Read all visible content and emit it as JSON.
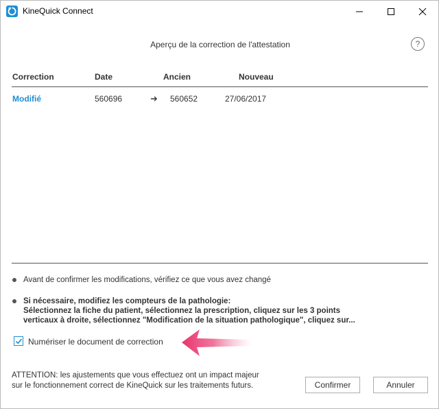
{
  "window": {
    "title": "KineQuick Connect",
    "icons": {
      "app": "kinequick-app-icon",
      "minimize": "minimize-icon",
      "maximize": "maximize-icon",
      "close": "close-icon"
    }
  },
  "dialog": {
    "title": "Aperçu de la correction de l'attestation",
    "help_icon": "?"
  },
  "table": {
    "headers": [
      "Correction",
      "Date",
      "Ancien",
      "Nouveau"
    ],
    "rows": [
      {
        "correction": "Modifié",
        "date": "560696",
        "arrow": "➜",
        "ancien": "560652",
        "nouveau": "27/06/2017"
      }
    ]
  },
  "notes": {
    "note1": "Avant de confirmer les modifications, vérifiez ce que vous avez changé",
    "note2_line1": "Si nécessaire, modifiez les compteurs de la pathologie:",
    "note2_line2": "Sélectionnez la fiche du patient, sélectionnez la prescription, cliquez sur les 3 points",
    "note2_line3": "verticaux à droite, sélectionnez \"Modification de la situation pathologique\", cliquez sur..."
  },
  "scan_option": {
    "label": "Numériser le document de correction",
    "checked": true
  },
  "warning": {
    "line1": "ATTENTION: les ajustements que vous effectuez ont un impact majeur",
    "line2": "sur le fonctionnement correct de KineQuick sur les traitements futurs."
  },
  "buttons": {
    "confirm": "Confirmer",
    "cancel": "Annuler"
  },
  "colors": {
    "accent": "#1f8fd3",
    "highlight_arrow": "#e8336d"
  }
}
